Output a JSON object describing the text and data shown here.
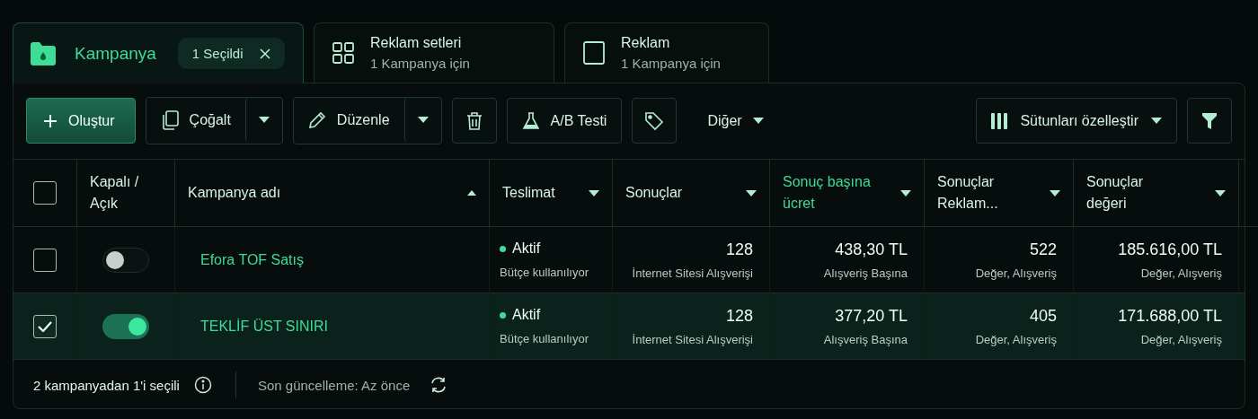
{
  "tabs": [
    {
      "label": "Kampanya",
      "badge": "1 Seçildi",
      "selected": true
    },
    {
      "label": "Reklam setleri",
      "subtitle": "1 Kampanya için",
      "selected": false
    },
    {
      "label": "Reklam",
      "subtitle": "1 Kampanya için",
      "selected": false
    }
  ],
  "toolbar": {
    "left": [
      {
        "kind": "primary",
        "label": "Oluştur"
      },
      {
        "kind": "split",
        "label": "Çoğalt"
      },
      {
        "kind": "split",
        "label": "Düzenle"
      },
      {
        "kind": "icon"
      },
      {
        "kind": "button",
        "label": "A/B Testi"
      },
      {
        "kind": "icon"
      },
      {
        "kind": "menu",
        "label": "Diğer"
      }
    ],
    "right": [
      {
        "kind": "split-menu",
        "label": "Sütunları özelleştir"
      },
      {
        "kind": "icon"
      }
    ]
  },
  "table": {
    "all_selected": false,
    "columns": [
      {
        "kind": "select"
      },
      {
        "label": "Kapalı / Açık",
        "sorted": false,
        "menu": false,
        "highlighted": false
      },
      {
        "label": "Kampanya adı",
        "sorted": true,
        "menu": false,
        "highlighted": false
      },
      {
        "label": "Teslimat",
        "sorted": false,
        "menu": true,
        "highlighted": false
      },
      {
        "label": "Sonuçlar",
        "sorted": false,
        "menu": true,
        "highlighted": false
      },
      {
        "label": "Sonuç başına ücret",
        "sorted": false,
        "menu": true,
        "highlighted": true
      },
      {
        "label": "Sonuçlar Reklam...",
        "sorted": false,
        "menu": true,
        "highlighted": false
      },
      {
        "label": "Sonuçlar değeri",
        "sorted": false,
        "menu": true,
        "highlighted": false
      }
    ],
    "rows": [
      {
        "selected": false,
        "on": false,
        "name": "Efora TOF Satış",
        "delivery": {
          "status": "Aktif",
          "detail": "Bütçe kullanılıyor",
          "color": "#3ddc97"
        },
        "metrics": [
          {
            "value": "128",
            "detail": "İnternet Sitesi Alışverişi"
          },
          {
            "value": "438,30 TL",
            "detail": "Alışveriş Başına"
          },
          {
            "value": "522",
            "detail": "Değer, Alışveriş"
          },
          {
            "value": "185.616,00 TL",
            "detail": "Değer, Alışveriş"
          }
        ]
      },
      {
        "selected": true,
        "on": true,
        "name": "TEKLİF ÜST SINIRI",
        "delivery": {
          "status": "Aktif",
          "detail": "Bütçe kullanılıyor",
          "color": "#3ddc97"
        },
        "metrics": [
          {
            "value": "128",
            "detail": "İnternet Sitesi Alışverişi"
          },
          {
            "value": "377,20 TL",
            "detail": "Alışveriş Başına"
          },
          {
            "value": "405",
            "detail": "Değer, Alışveriş"
          },
          {
            "value": "171.688,00 TL",
            "detail": "Değer, Alışveriş"
          }
        ]
      }
    ]
  },
  "status_bar": {
    "selection": "2 kampanyadan 1'i seçili",
    "updated": "Son güncelleme: Az önce"
  }
}
